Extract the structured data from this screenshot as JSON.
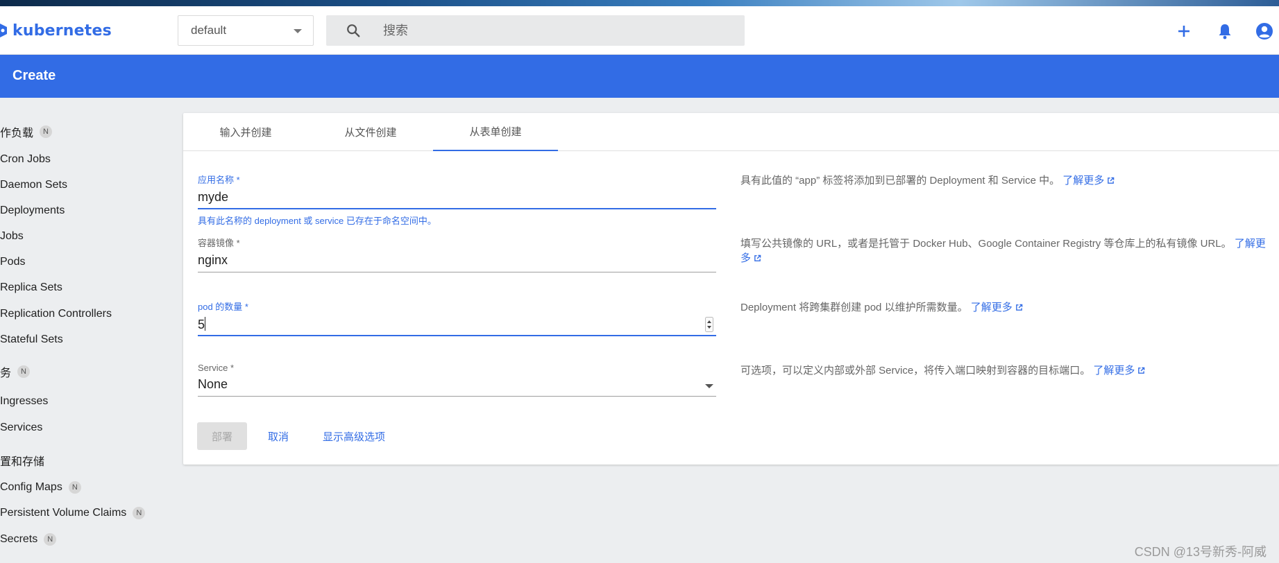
{
  "topbar": {
    "brand": "kubernetes",
    "namespace": "default",
    "search_placeholder": "搜索",
    "icons": [
      "plus-icon",
      "bell-icon",
      "account-icon"
    ]
  },
  "header": {
    "title": "Create"
  },
  "sidebar": {
    "sections": [
      {
        "label": "作负载",
        "badge": "N"
      },
      {
        "label": "务",
        "badge": "N"
      },
      {
        "label": "置和存储",
        "badge": ""
      }
    ],
    "workloads": [
      "Cron Jobs",
      "Daemon Sets",
      "Deployments",
      "Jobs",
      "Pods",
      "Replica Sets",
      "Replication Controllers",
      "Stateful Sets"
    ],
    "services": [
      "Ingresses",
      "Services"
    ],
    "config": [
      {
        "label": "Config Maps",
        "badge": "N"
      },
      {
        "label": "Persistent Volume Claims",
        "badge": "N"
      },
      {
        "label": "Secrets",
        "badge": "N"
      }
    ]
  },
  "tabs": [
    "输入并创建",
    "从文件创建",
    "从表单创建"
  ],
  "active_tab": 2,
  "form": {
    "app_name": {
      "label": "应用名称 *",
      "value": "myde",
      "error": "具有此名称的 deployment 或 service 已存在于命名空间中。"
    },
    "image": {
      "label": "容器镜像 *",
      "value": "nginx"
    },
    "pods": {
      "label": "pod 的数量 *",
      "value": "5"
    },
    "service": {
      "label": "Service *",
      "value": "None"
    }
  },
  "descriptions": {
    "app_name": "具有此值的 “app” 标签将添加到已部署的 Deployment 和 Service 中。",
    "image": "填写公共镜像的 URL，或者是托管于 Docker Hub、Google Container Registry 等仓库上的私有镜像 URL。",
    "pods": "Deployment 将跨集群创建 pod 以维护所需数量。",
    "service": "可选项，可以定义内部或外部 Service，将传入端口映射到容器的目标端口。",
    "learn_more": "了解更多"
  },
  "actions": {
    "deploy": "部署",
    "cancel": "取消",
    "advanced": "显示高级选项"
  },
  "watermark": "CSDN @13号新秀-阿威",
  "colors": {
    "primary": "#326ce5",
    "background": "#eceef0"
  }
}
